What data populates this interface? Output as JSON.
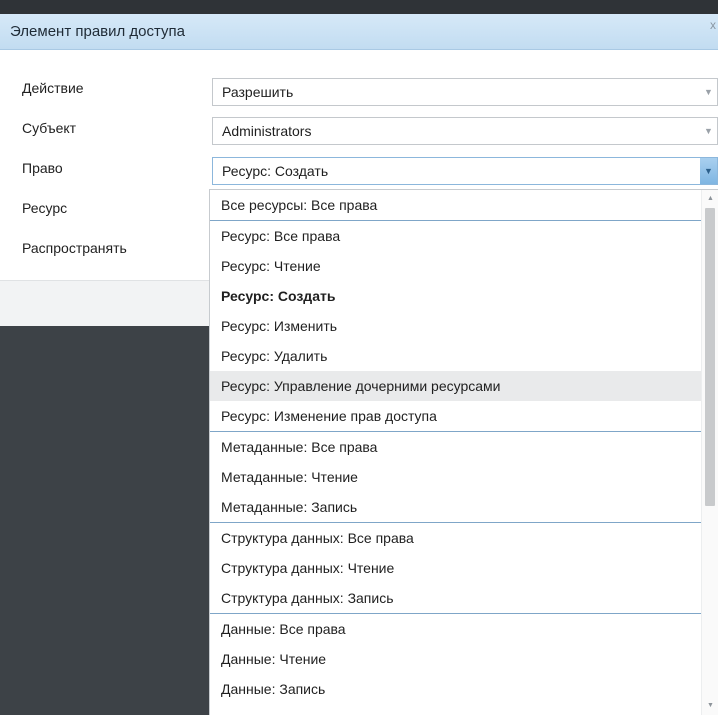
{
  "dialog": {
    "title": "Элемент правил доступа",
    "close_label": "x"
  },
  "form": {
    "rows": [
      {
        "label": "Действие",
        "value": "Разрешить"
      },
      {
        "label": "Субъект",
        "value": "Administrators"
      },
      {
        "label": "Право",
        "value": "Ресурс: Создать"
      },
      {
        "label": "Ресурс"
      },
      {
        "label": "Распространять"
      }
    ]
  },
  "dropdown": {
    "items": [
      "Все ресурсы: Все права",
      "Ресурс: Все права",
      "Ресурс: Чтение",
      "Ресурс: Создать",
      "Ресурс: Изменить",
      "Ресурс: Удалить",
      "Ресурс: Управление дочерними ресурсами",
      "Ресурс: Изменение прав доступа",
      "Метаданные: Все права",
      "Метаданные: Чтение",
      "Метаданные: Запись",
      "Структура данных: Все права",
      "Структура данных: Чтение",
      "Структура данных: Запись",
      "Данные: Все права",
      "Данные: Чтение",
      "Данные: Запись"
    ],
    "selected_index": 3,
    "hover_index": 6,
    "scroll_position": 0
  },
  "icons": {
    "combo_arrow": "triangle-down-icon",
    "scroll_up": "triangle-up-icon",
    "scroll_down": "triangle-down-icon"
  },
  "colors": {
    "titlebar": "#c2dcf1",
    "separator": "#7fa6c8",
    "active_arrow": "#7fb6e2"
  }
}
